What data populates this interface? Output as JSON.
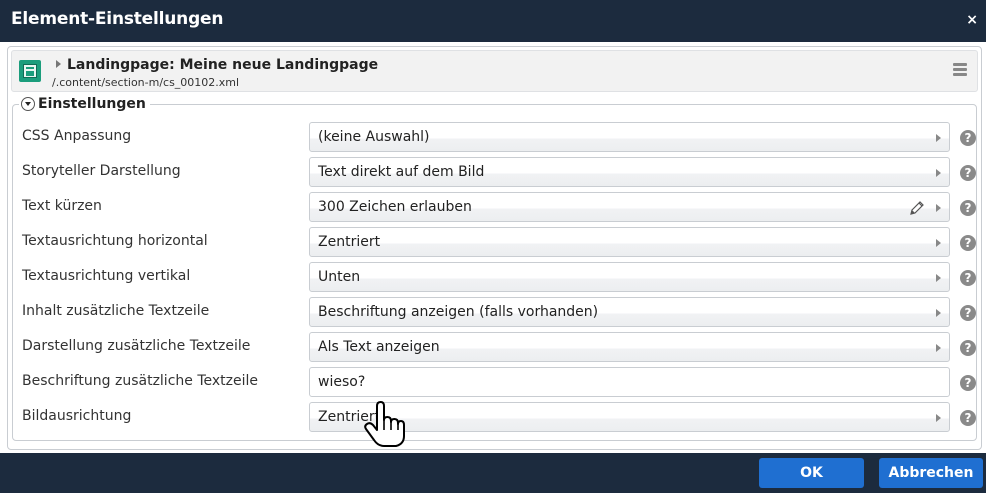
{
  "dialog": {
    "title": "Element-Einstellungen",
    "close_label": "×"
  },
  "element": {
    "page_title": "Landingpage: Meine neue Landingpage",
    "path": "/.content/section-m/cs_00102.xml",
    "icon": "landingpage-resource-icon"
  },
  "settings": {
    "legend": "Einstellungen",
    "rows": [
      {
        "label": "CSS Anpassung",
        "value": "(keine Auswahl)",
        "kind": "select"
      },
      {
        "label": "Storyteller Darstellung",
        "value": "Text direkt auf dem Bild",
        "kind": "select"
      },
      {
        "label": "Text kürzen",
        "value": "300 Zeichen erlauben",
        "kind": "select-edit"
      },
      {
        "label": "Textausrichtung horizontal",
        "value": "Zentriert",
        "kind": "select"
      },
      {
        "label": "Textausrichtung vertikal",
        "value": "Unten",
        "kind": "select"
      },
      {
        "label": "Inhalt zusätzliche Textzeile",
        "value": "Beschriftung anzeigen (falls vorhanden)",
        "kind": "select"
      },
      {
        "label": "Darstellung zusätzliche Textzeile",
        "value": "Als Text anzeigen",
        "kind": "select"
      },
      {
        "label": "Beschriftung zusätzliche Textzeile",
        "value": "wieso?",
        "kind": "text"
      },
      {
        "label": "Bildausrichtung",
        "value": "Zentriert",
        "kind": "select"
      }
    ],
    "help_glyph": "?"
  },
  "footer": {
    "ok_label": "OK",
    "cancel_label": "Abbrechen"
  },
  "colors": {
    "titlebar": "#1c2b3e",
    "button": "#1f6fd1",
    "icon_green": "#1b9d7c"
  }
}
